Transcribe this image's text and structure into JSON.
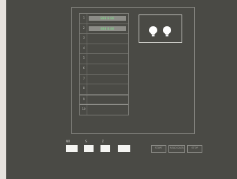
{
  "slots": [
    {
      "num": "1",
      "value": "888 8.88",
      "filled": true
    },
    {
      "num": "2",
      "value": "888 8.88",
      "filled": true
    },
    {
      "num": "3",
      "value": "",
      "filled": false
    },
    {
      "num": "4",
      "value": "",
      "filled": false
    },
    {
      "num": "5",
      "value": "",
      "filled": false
    },
    {
      "num": "6",
      "value": "",
      "filled": false
    },
    {
      "num": "7",
      "value": "",
      "filled": false
    },
    {
      "num": "8",
      "value": "",
      "filled": false
    },
    {
      "num": "9",
      "value": "",
      "filled": false
    },
    {
      "num": "10",
      "value": "",
      "filled": false
    }
  ],
  "controls": {
    "label_1": "NO",
    "label_2": "S",
    "label_3": "Z"
  },
  "actions": [
    {
      "label": "START"
    },
    {
      "label": "READ DATA"
    },
    {
      "label": "STOP"
    }
  ],
  "colors": {
    "screen_bg": "#4a4a45",
    "value_text": "#7fe08a",
    "bulb": "#ffffff"
  },
  "icons": {
    "status_graphic": "bulb-icon"
  }
}
